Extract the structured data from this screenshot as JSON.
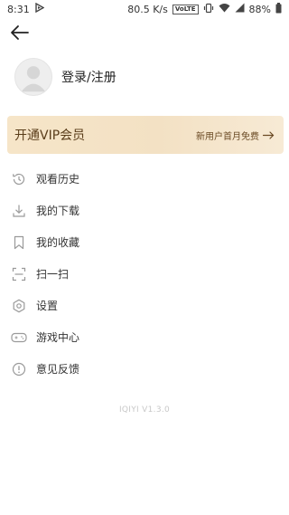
{
  "status_bar": {
    "time": "8:31",
    "network_speed": "80.5 K/s",
    "volte_badge": "VoLTE",
    "battery": "88%",
    "icons": [
      "notification-icon",
      "vibrate-icon",
      "wifi-icon",
      "signal-icon",
      "battery-icon"
    ]
  },
  "header": {
    "back_icon": "arrow-left-icon"
  },
  "profile": {
    "login_label": "登录/注册",
    "avatar_icon": "default-avatar-icon"
  },
  "vip_banner": {
    "title": "开通VIP会员",
    "promo": "新用户首月免费",
    "arrow_icon": "arrow-right-icon",
    "colors": {
      "background": "#f5e4c8",
      "text": "#5a3d1a"
    }
  },
  "menu": {
    "items": [
      {
        "label": "观看历史",
        "icon": "history-icon"
      },
      {
        "label": "我的下载",
        "icon": "download-icon"
      },
      {
        "label": "我的收藏",
        "icon": "bookmark-icon"
      },
      {
        "label": "扫一扫",
        "icon": "scan-icon"
      },
      {
        "label": "设置",
        "icon": "settings-icon"
      },
      {
        "label": "游戏中心",
        "icon": "gamepad-icon"
      },
      {
        "label": "意见反馈",
        "icon": "feedback-icon"
      }
    ]
  },
  "footer": {
    "version": "IQIYI V1.3.0"
  }
}
